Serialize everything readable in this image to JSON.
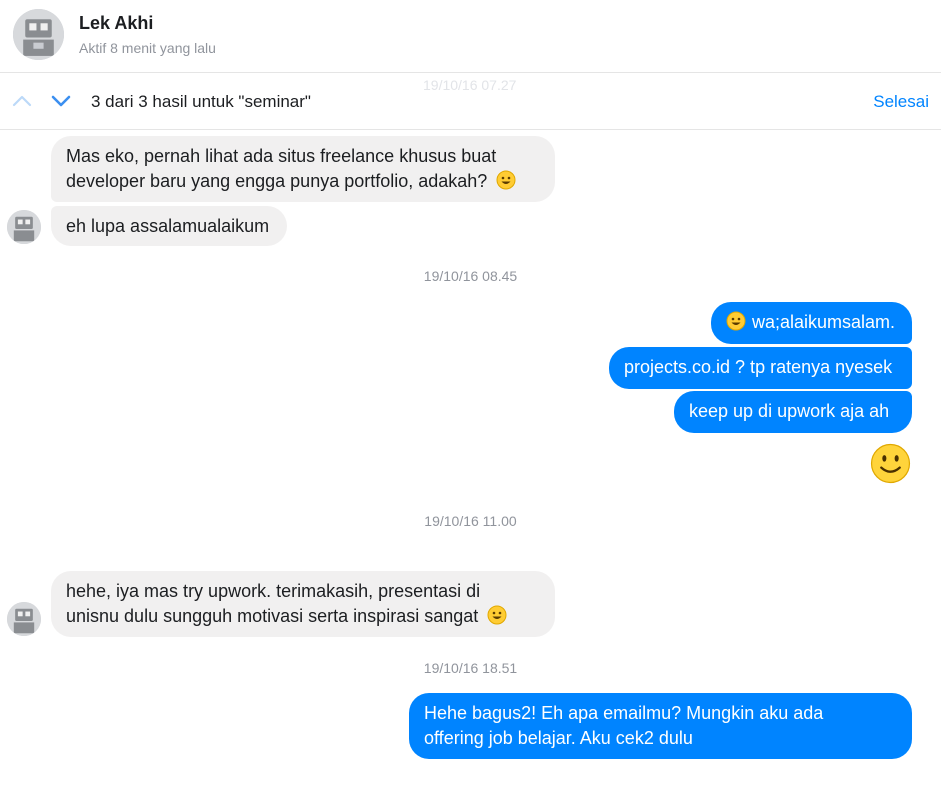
{
  "header": {
    "contact_name": "Lek Akhi",
    "status": "Aktif 8 menit yang lalu"
  },
  "search": {
    "result_text": "3 dari 3 hasil untuk \"seminar\"",
    "done_label": "Selesai",
    "faded_timestamp": "19/10/16 07.27"
  },
  "timestamps": [
    "19/10/16 08.45",
    "19/10/16 11.00",
    "19/10/16 18.51"
  ],
  "messages": {
    "m1": {
      "line1": "Mas eko, pernah lihat ada situs freelance khusus buat",
      "line2": "developer baru yang engga punya portfolio, adakah?"
    },
    "m2": "eh lupa assalamualaikum",
    "m3": "wa;alaikumsalam.",
    "m4": "projects.co.id ? tp ratenya nyesek",
    "m5": "keep up di upwork aja ah",
    "m6": {
      "line1": "hehe, iya mas try upwork. terimakasih, presentasi di",
      "line2": "unisnu dulu sungguh motivasi serta inspirasi sangat"
    },
    "m7": {
      "line1": "Hehe bagus2! Eh apa emailmu? Mungkin aku ada",
      "line2": "offering job belajar. Aku cek2 dulu"
    }
  },
  "icons": {
    "smiley": "grinning-emoji",
    "big_smiley": "smiling-emoji",
    "nav_up": "chevron-up-icon",
    "nav_down": "chevron-down-icon"
  },
  "colors": {
    "accent": "#0084ff",
    "incoming_bubble": "#f1f0f0",
    "muted_text": "#90949c"
  }
}
